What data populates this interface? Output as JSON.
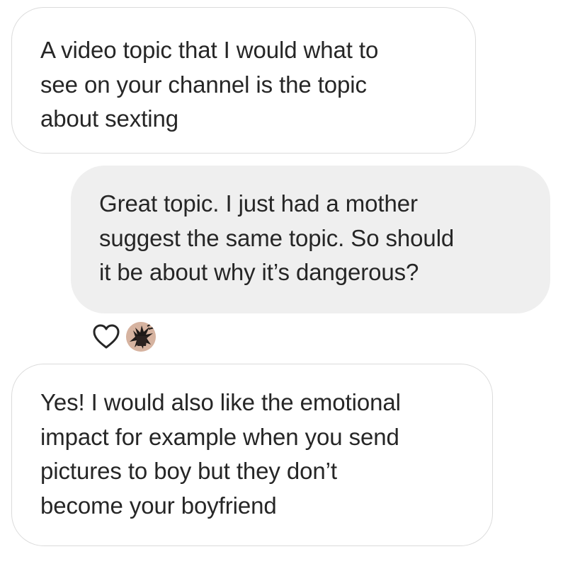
{
  "conversation": {
    "messages": [
      {
        "direction": "received",
        "lines": [
          "A video topic that I would what to",
          "see on your channel is the topic",
          "about sexting"
        ]
      },
      {
        "direction": "sent",
        "lines": [
          "Great topic. I just had a mother",
          "suggest the same topic. So should",
          "it be about why it’s dangerous?"
        ],
        "reaction": {
          "icon": "heart-outline-icon",
          "reactor_avatar": "avatar"
        }
      },
      {
        "direction": "received",
        "lines": [
          "Yes! I would also like the emotional",
          "impact for example when you send",
          "pictures to boy but they don’t",
          "become your boyfriend"
        ]
      }
    ]
  },
  "colors": {
    "sent_bubble_bg": "#efefef",
    "received_bubble_border": "#dbdbdb",
    "text": "#262626"
  }
}
